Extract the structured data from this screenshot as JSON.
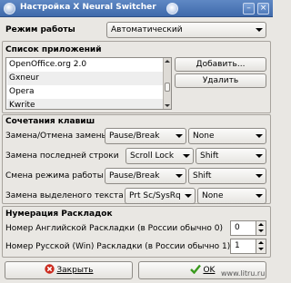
{
  "window": {
    "title": "Настройка X Neural Switcher"
  },
  "mode": {
    "label": "Режим работы",
    "value": "Автоматический"
  },
  "apps": {
    "label": "Список приложений",
    "items": [
      "OpenOffice.org 2.0",
      "Gxneur",
      "Opera",
      "Kwrite"
    ],
    "add_label": "Добавить...",
    "remove_label": "Удалить"
  },
  "hotkeys": {
    "label": "Сочетания клавиш",
    "rows": [
      {
        "label": "Замена/Отмена замены",
        "key": "Pause/Break",
        "modifier": "None"
      },
      {
        "label": "Замена последней строки",
        "key": "Scroll Lock",
        "modifier": "Shift"
      },
      {
        "label": "Смена режима работы",
        "key": "Pause/Break",
        "modifier": "Shift"
      },
      {
        "label": "Замена выделеного текста",
        "key": "Prt Sc/SysRq",
        "modifier": "None"
      }
    ]
  },
  "layouts": {
    "label": "Нумерация Раскладок",
    "english_label": "Номер Английской Раскладки (в России обычно 0)",
    "english_value": "0",
    "russian_label": "Номер Русской (Win) Раскладки (в России обычно 1)",
    "russian_value": "1"
  },
  "footer": {
    "close_label": "Закрыть",
    "ok_label": "OK"
  },
  "watermark": "www.litru.ru",
  "icons": [
    "app-icon",
    "shade-icon",
    "minimize-icon",
    "close-icon",
    "close-x-icon",
    "checkmark-icon"
  ]
}
